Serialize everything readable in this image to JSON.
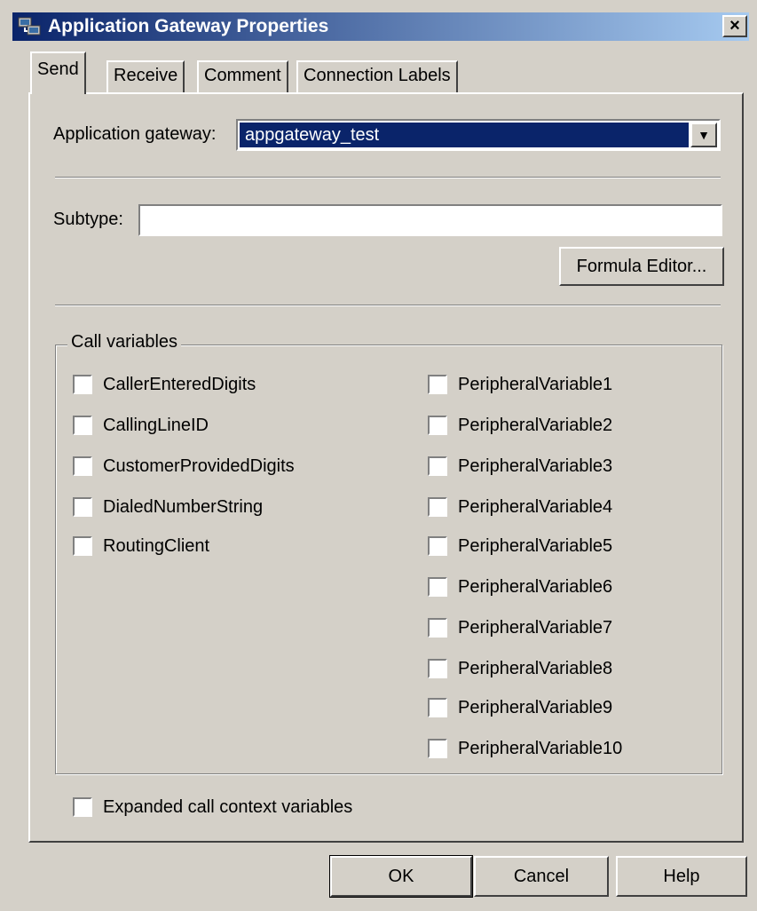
{
  "window": {
    "title": "Application Gateway Properties",
    "close_label": "×"
  },
  "tabs": [
    "Send",
    "Receive",
    "Comment",
    "Connection Labels"
  ],
  "send_tab": {
    "gateway_label": "Application gateway:",
    "gateway_value": "appgateway_test",
    "dropdown_arrow": "▼",
    "subtype_label": "Subtype:",
    "subtype_value": "",
    "formula_editor_label": "Formula Editor...",
    "call_variables_title": "Call variables",
    "left_vars": [
      "CallerEnteredDigits",
      "CallingLineID",
      "CustomerProvidedDigits",
      "DialedNumberString",
      "RoutingClient"
    ],
    "right_vars": [
      "PeripheralVariable1",
      "PeripheralVariable2",
      "PeripheralVariable3",
      "PeripheralVariable4",
      "PeripheralVariable5",
      "PeripheralVariable6",
      "PeripheralVariable7",
      "PeripheralVariable8",
      "PeripheralVariable9",
      "PeripheralVariable10"
    ],
    "expanded_label": "Expanded call context variables"
  },
  "buttons": {
    "ok": "OK",
    "cancel": "Cancel",
    "help": "Help"
  }
}
